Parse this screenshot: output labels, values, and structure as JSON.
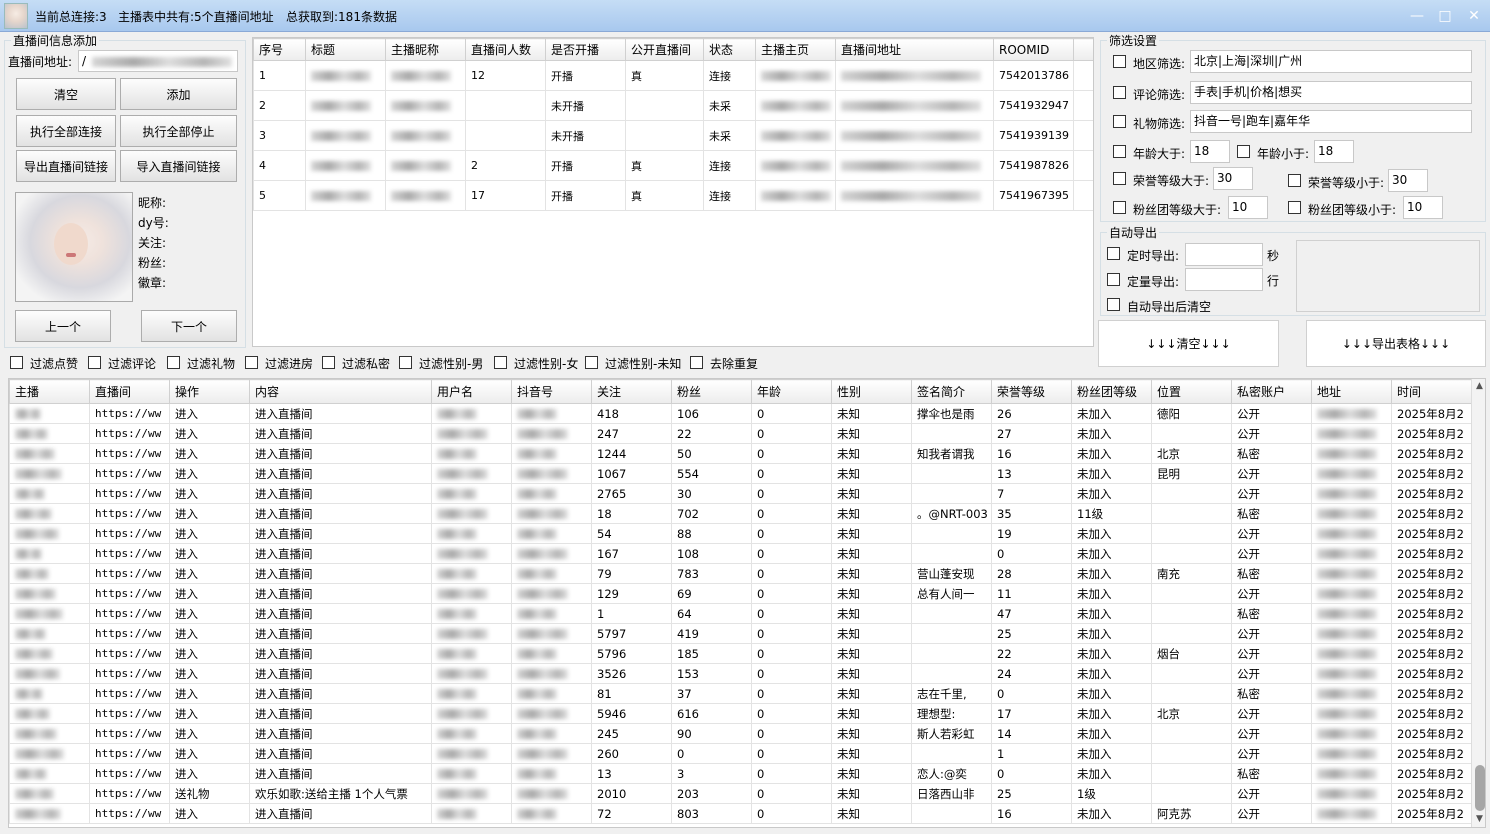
{
  "title": {
    "connections": "当前总连接:3",
    "anchors": "主播表中共有:5个直播间地址",
    "total": "总获取到:181条数据"
  },
  "left": {
    "group_label": "直播间信息添加",
    "addr_label": "直播间地址:",
    "addr_value": "/",
    "buttons": [
      "清空",
      "添加",
      "执行全部连接",
      "执行全部停止",
      "导出直播间链接",
      "导入直播间链接"
    ],
    "info_labels": [
      "昵称:",
      "dy号:",
      "关注:",
      "粉丝:",
      "徽章:"
    ],
    "prev": "上一个",
    "next": "下一个"
  },
  "top_table": {
    "headers": [
      "序号",
      "标题",
      "主播昵称",
      "直播间人数",
      "是否开播",
      "公开直播间",
      "状态",
      "主播主页",
      "直播间地址",
      "ROOMID"
    ],
    "rows": [
      {
        "no": "1",
        "count": "12",
        "live": "开播",
        "public": "真",
        "status": "连接",
        "roomid": "7542013786"
      },
      {
        "no": "2",
        "count": "",
        "live": "未开播",
        "public": "",
        "status": "未采",
        "roomid": "7541932947"
      },
      {
        "no": "3",
        "count": "",
        "live": "未开播",
        "public": "",
        "status": "未采",
        "roomid": "7541939139"
      },
      {
        "no": "4",
        "count": "2",
        "live": "开播",
        "public": "真",
        "status": "连接",
        "roomid": "7541987826"
      },
      {
        "no": "5",
        "count": "17",
        "live": "开播",
        "public": "真",
        "status": "连接",
        "roomid": "7541967395"
      }
    ]
  },
  "filter": {
    "group_label": "筛选设置",
    "region_label": "地区筛选:",
    "region_value": "北京|上海|深圳|广州",
    "comment_label": "评论筛选:",
    "comment_value": "手表|手机|价格|想买",
    "gift_label": "礼物筛选:",
    "gift_value": "抖音一号|跑车|嘉年华",
    "age_gt_label": "年龄大于:",
    "age_gt_value": "18",
    "age_lt_label": "年龄小于:",
    "age_lt_value": "18",
    "honor_gt_label": "荣誉等级大于:",
    "honor_gt_value": "30",
    "honor_lt_label": "荣誉等级小于:",
    "honor_lt_value": "30",
    "fan_gt_label": "粉丝团等级大于:",
    "fan_gt_value": "10",
    "fan_lt_label": "粉丝团等级小于:",
    "fan_lt_value": "10"
  },
  "auto_export": {
    "group_label": "自动导出",
    "timed_label": "定时导出:",
    "timed_unit": "秒",
    "count_label": "定量导出:",
    "count_unit": "行",
    "clear_label": "自动导出后清空",
    "clear_btn": "↓↓↓清空↓↓↓",
    "export_btn": "↓↓↓导出表格↓↓↓"
  },
  "filters_row": [
    "过滤点赞",
    "过滤评论",
    "过滤礼物",
    "过滤进房",
    "过滤私密",
    "过滤性别-男",
    "过滤性别-女",
    "过滤性别-未知",
    "去除重复"
  ],
  "bottom_table": {
    "headers": [
      "主播",
      "直播间",
      "操作",
      "内容",
      "用户名",
      "抖音号",
      "关注",
      "粉丝",
      "年龄",
      "性别",
      "签名简介",
      "荣誉等级",
      "粉丝团等级",
      "位置",
      "私密账户",
      "地址",
      "时间"
    ],
    "link_text": "https://ww",
    "time_text": "2025年8月2",
    "rows": [
      {
        "op": "进入",
        "content": "进入直播间",
        "follow": "418",
        "fans": "106",
        "age": "0",
        "gender": "未知",
        "sig": "撑伞也是雨",
        "honor": "26",
        "fan": "未加入",
        "loc": "德阳",
        "priv": "公开"
      },
      {
        "op": "进入",
        "content": "进入直播间",
        "follow": "247",
        "fans": "22",
        "age": "0",
        "gender": "未知",
        "sig": "",
        "honor": "27",
        "fan": "未加入",
        "loc": "",
        "priv": "公开"
      },
      {
        "op": "进入",
        "content": "进入直播间",
        "follow": "1244",
        "fans": "50",
        "age": "0",
        "gender": "未知",
        "sig": "知我者谓我",
        "honor": "16",
        "fan": "未加入",
        "loc": "北京",
        "priv": "私密"
      },
      {
        "op": "进入",
        "content": "进入直播间",
        "follow": "1067",
        "fans": "554",
        "age": "0",
        "gender": "未知",
        "sig": "",
        "honor": "13",
        "fan": "未加入",
        "loc": "昆明",
        "priv": "公开"
      },
      {
        "op": "进入",
        "content": "进入直播间",
        "follow": "2765",
        "fans": "30",
        "age": "0",
        "gender": "未知",
        "sig": "",
        "honor": "7",
        "fan": "未加入",
        "loc": "",
        "priv": "公开"
      },
      {
        "op": "进入",
        "content": "进入直播间",
        "follow": "18",
        "fans": "702",
        "age": "0",
        "gender": "未知",
        "sig": "。@NRT-003",
        "honor": "35",
        "fan": "11级",
        "loc": "",
        "priv": "私密"
      },
      {
        "op": "进入",
        "content": "进入直播间",
        "follow": "54",
        "fans": "88",
        "age": "0",
        "gender": "未知",
        "sig": "",
        "honor": "19",
        "fan": "未加入",
        "loc": "",
        "priv": "公开"
      },
      {
        "op": "进入",
        "content": "进入直播间",
        "follow": "167",
        "fans": "108",
        "age": "0",
        "gender": "未知",
        "sig": "",
        "honor": "0",
        "fan": "未加入",
        "loc": "",
        "priv": "公开"
      },
      {
        "op": "进入",
        "content": "进入直播间",
        "follow": "79",
        "fans": "783",
        "age": "0",
        "gender": "未知",
        "sig": "营山蓬安现",
        "honor": "28",
        "fan": "未加入",
        "loc": "南充",
        "priv": "私密"
      },
      {
        "op": "进入",
        "content": "进入直播间",
        "follow": "129",
        "fans": "69",
        "age": "0",
        "gender": "未知",
        "sig": "总有人间一",
        "honor": "11",
        "fan": "未加入",
        "loc": "",
        "priv": "公开"
      },
      {
        "op": "进入",
        "content": "进入直播间",
        "follow": "1",
        "fans": "64",
        "age": "0",
        "gender": "未知",
        "sig": "",
        "honor": "47",
        "fan": "未加入",
        "loc": "",
        "priv": "私密"
      },
      {
        "op": "进入",
        "content": "进入直播间",
        "follow": "5797",
        "fans": "419",
        "age": "0",
        "gender": "未知",
        "sig": "",
        "honor": "25",
        "fan": "未加入",
        "loc": "",
        "priv": "公开"
      },
      {
        "op": "进入",
        "content": "进入直播间",
        "follow": "5796",
        "fans": "185",
        "age": "0",
        "gender": "未知",
        "sig": "",
        "honor": "22",
        "fan": "未加入",
        "loc": "烟台",
        "priv": "公开"
      },
      {
        "op": "进入",
        "content": "进入直播间",
        "follow": "3526",
        "fans": "153",
        "age": "0",
        "gender": "未知",
        "sig": "",
        "honor": "24",
        "fan": "未加入",
        "loc": "",
        "priv": "公开"
      },
      {
        "op": "进入",
        "content": "进入直播间",
        "follow": "81",
        "fans": "37",
        "age": "0",
        "gender": "未知",
        "sig": "志在千里,",
        "honor": "0",
        "fan": "未加入",
        "loc": "",
        "priv": "私密"
      },
      {
        "op": "进入",
        "content": "进入直播间",
        "follow": "5946",
        "fans": "616",
        "age": "0",
        "gender": "未知",
        "sig": "理想型:",
        "honor": "17",
        "fan": "未加入",
        "loc": "北京",
        "priv": "公开"
      },
      {
        "op": "进入",
        "content": "进入直播间",
        "follow": "245",
        "fans": "90",
        "age": "0",
        "gender": "未知",
        "sig": "斯人若彩虹",
        "honor": "14",
        "fan": "未加入",
        "loc": "",
        "priv": "公开"
      },
      {
        "op": "进入",
        "content": "进入直播间",
        "follow": "260",
        "fans": "0",
        "age": "0",
        "gender": "未知",
        "sig": "",
        "honor": "1",
        "fan": "未加入",
        "loc": "",
        "priv": "公开"
      },
      {
        "op": "进入",
        "content": "进入直播间",
        "follow": "13",
        "fans": "3",
        "age": "0",
        "gender": "未知",
        "sig": "恋人:@奕",
        "honor": "0",
        "fan": "未加入",
        "loc": "",
        "priv": "私密"
      },
      {
        "op": "送礼物",
        "content": "欢乐如歌:送给主播 1个人气票",
        "follow": "2010",
        "fans": "203",
        "age": "0",
        "gender": "未知",
        "sig": "日落西山非",
        "honor": "25",
        "fan": "1级",
        "loc": "",
        "priv": "公开"
      },
      {
        "op": "进入",
        "content": "进入直播间",
        "follow": "72",
        "fans": "803",
        "age": "0",
        "gender": "未知",
        "sig": "",
        "honor": "16",
        "fan": "未加入",
        "loc": "阿克苏",
        "priv": "公开"
      }
    ]
  }
}
